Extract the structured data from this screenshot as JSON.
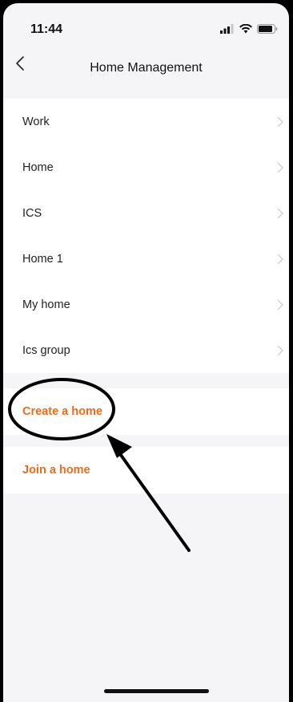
{
  "status_bar": {
    "time": "11:44",
    "icons": [
      "signal-icon",
      "wifi-icon",
      "battery-icon"
    ]
  },
  "nav": {
    "title": "Home Management",
    "back_icon": "chevron-left-icon"
  },
  "homes": [
    {
      "label": "Work"
    },
    {
      "label": "Home"
    },
    {
      "label": "ICS"
    },
    {
      "label": "Home 1"
    },
    {
      "label": "My home"
    },
    {
      "label": "Ics group"
    }
  ],
  "actions": {
    "create_label": "Create a home",
    "join_label": "Join a home"
  },
  "colors": {
    "accent": "#f06a1c",
    "background": "#f5f5f7",
    "row_background": "#ffffff",
    "text": "#222222",
    "chevron": "#c7c7cc",
    "annotation": "#000000"
  }
}
